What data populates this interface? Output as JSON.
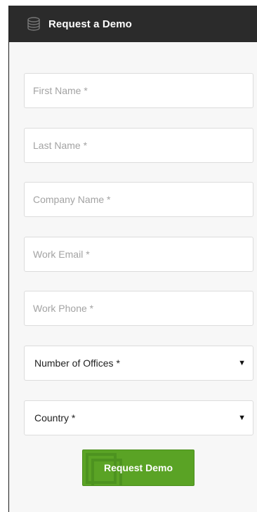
{
  "header": {
    "title": "Request a Demo",
    "icon": "database-icon"
  },
  "form": {
    "first_name_placeholder": "First Name *",
    "last_name_placeholder": "Last Name *",
    "company_name_placeholder": "Company Name *",
    "work_email_placeholder": "Work Email *",
    "work_phone_placeholder": "Work Phone *",
    "offices_select": "Number of Offices *",
    "country_select": "Country *",
    "submit_label": "Request Demo"
  },
  "colors": {
    "header_bg": "#2b2b2b",
    "button_green": "#5aa325"
  }
}
